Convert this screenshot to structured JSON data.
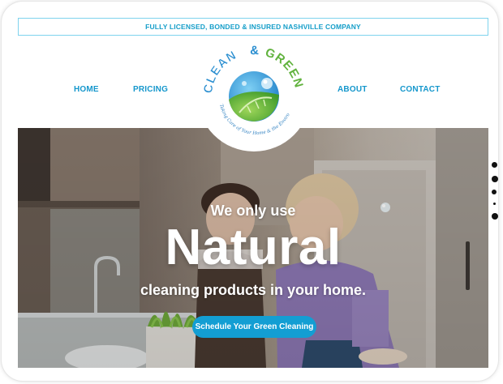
{
  "topbar": {
    "text": "FULLY LICENSED, BONDED & INSURED NASHVILLE COMPANY"
  },
  "nav": {
    "home": "HOME",
    "pricing": "PRICING",
    "about": "ABOUT",
    "contact": "CONTACT"
  },
  "logo": {
    "word1": "CLEAN",
    "amp": "&",
    "word2": "GREEN",
    "tagline": "Taking Care of Your Home & the Environment"
  },
  "hero": {
    "pre": "We only use",
    "main": "Natural",
    "sub": "cleaning products in your home.",
    "cta": "Schedule Your Green Cleaning"
  },
  "colors": {
    "accent": "#139ed3",
    "nav_text": "#1597cc",
    "logo_green": "#62b33f",
    "logo_blue": "#2a8ed0"
  },
  "icons": {
    "logo": "earth-leaf-logo-icon",
    "pagination": "pagination-dots"
  }
}
